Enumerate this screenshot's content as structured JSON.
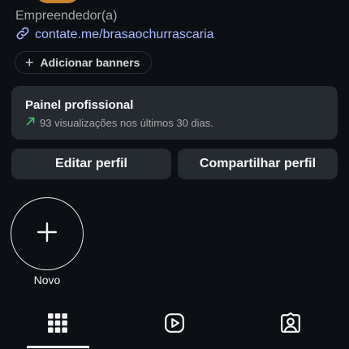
{
  "profile": {
    "category": "Empreendedor(a)",
    "link": "contate.me/brasaochurrascaria"
  },
  "banner_button": {
    "label": "Adicionar banners"
  },
  "professional_panel": {
    "title": "Painel profissional",
    "stats": "93 visualizações nos últimos 30 dias."
  },
  "actions": {
    "edit_label": "Editar perfil",
    "share_label": "Compartilhar perfil"
  },
  "highlights": {
    "new_label": "Novo"
  },
  "tabs": [
    {
      "name": "posts-grid",
      "icon": "grid-icon",
      "active": true
    },
    {
      "name": "reels",
      "icon": "reels-play-icon",
      "active": false
    },
    {
      "name": "tagged",
      "icon": "tagged-person-icon",
      "active": false
    }
  ],
  "colors": {
    "background": "#0c0f14",
    "card": "#262a31",
    "link": "#a9b8ff",
    "trend": "#3ec46d",
    "avatar_ring": "#c8842e"
  }
}
